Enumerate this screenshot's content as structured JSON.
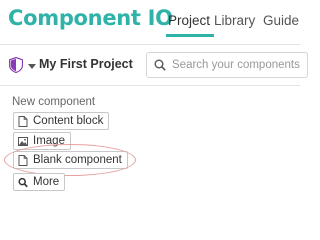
{
  "app": {
    "logo_text": "Component IO",
    "accent_color": "#2fb3a8"
  },
  "nav": {
    "tabs": [
      {
        "label": "Project",
        "active": true
      },
      {
        "label": "Library",
        "active": false
      },
      {
        "label": "Guide",
        "active": false
      }
    ]
  },
  "toolbar": {
    "project_icon": "shield-icon",
    "project_name": "My First Project",
    "search_placeholder": "Search your components",
    "search_value": ""
  },
  "new_component": {
    "title": "New component",
    "buttons": [
      {
        "label": "Content block",
        "icon": "file-icon"
      },
      {
        "label": "Image",
        "icon": "image-icon"
      },
      {
        "label": "Blank component",
        "icon": "file-icon",
        "highlighted": true
      },
      {
        "label": "More",
        "icon": "search-icon"
      }
    ],
    "highlight_color": "#e8a0a0"
  }
}
